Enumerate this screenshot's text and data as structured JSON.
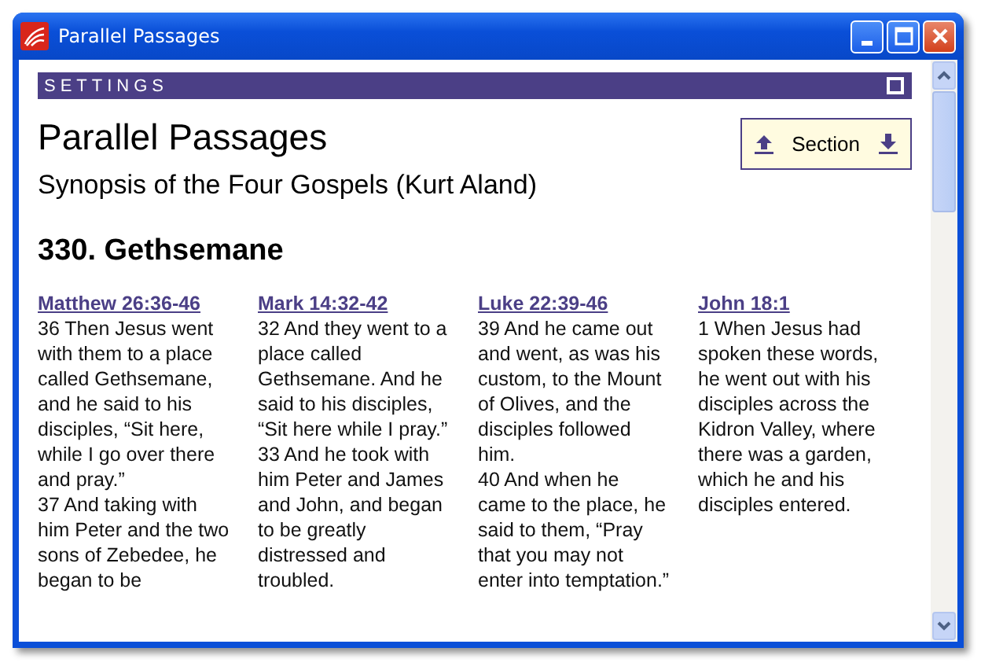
{
  "window": {
    "title": "Parallel Passages"
  },
  "settings_bar": {
    "label": "SETTINGS"
  },
  "title": "Parallel Passages",
  "subtitle": "Synopsis of the Four Gospels (Kurt Aland)",
  "section_button": {
    "label": "Section"
  },
  "section_heading": "330. Gethsemane",
  "passages": [
    {
      "reference": "Matthew 26:36-46",
      "verses": [
        "36 Then Jesus went with them to a place called Gethsemane, and he said to his disciples, “Sit here, while I go over there and pray.”",
        "37 And taking with him Peter and the two sons of Zebedee, he began to be"
      ]
    },
    {
      "reference": "Mark 14:32-42",
      "verses": [
        "32 And they went to a place called Gethsemane. And he said to his disciples, “Sit here while I pray.”",
        "33 And he took with him Peter and James and John, and began to be greatly distressed and troubled."
      ]
    },
    {
      "reference": "Luke 22:39-46",
      "verses": [
        "39 And he came out and went, as was his custom, to the Mount of Olives, and the disciples followed him.",
        "40 And when he came to the place, he said to them, “Pray that you may not enter into temptation.”"
      ]
    },
    {
      "reference": "John 18:1",
      "verses": [
        "1 When Jesus had spoken these words, he went out with his disciples across the Kidron Valley, where there was a garden, which he and his disciples entered."
      ]
    }
  ]
}
